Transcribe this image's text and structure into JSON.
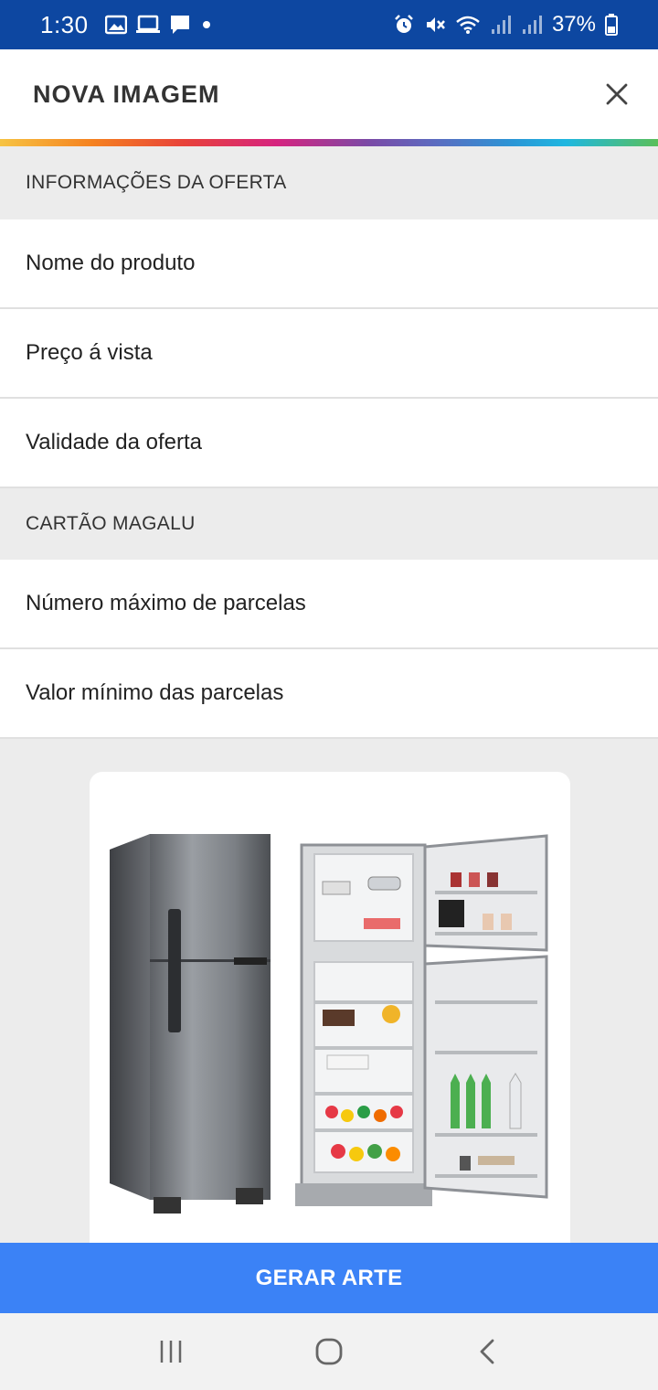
{
  "status_bar": {
    "time": "1:30",
    "battery": "37%",
    "left_icons": [
      "image-icon",
      "laptop-icon",
      "chat-icon",
      "dot-icon"
    ],
    "right_icons": [
      "alarm-icon",
      "mute-icon",
      "wifi-icon",
      "signal-icon",
      "signal-icon",
      "battery-icon"
    ]
  },
  "header": {
    "title": "NOVA IMAGEM",
    "close_icon": "close-icon"
  },
  "form": {
    "section_offer": "INFORMAÇÕES DA OFERTA",
    "product_name_placeholder": "Nome do produto",
    "price_placeholder": "Preço á vista",
    "validity_placeholder": "Validade da oferta",
    "section_card": "CARTÃO MAGALU",
    "max_installments_placeholder": "Número máximo de parcelas",
    "min_installment_placeholder": "Valor mínimo das parcelas"
  },
  "image_preview": {
    "subject": "refrigerator-image"
  },
  "action": {
    "generate_label": "GERAR ARTE"
  },
  "nav": {
    "recents_icon": "recents-icon",
    "home_icon": "home-icon",
    "back_icon": "back-icon"
  },
  "colors": {
    "status_bar": "#0d47a1",
    "action_button": "#3b82f6",
    "section_bg": "#ececec"
  }
}
